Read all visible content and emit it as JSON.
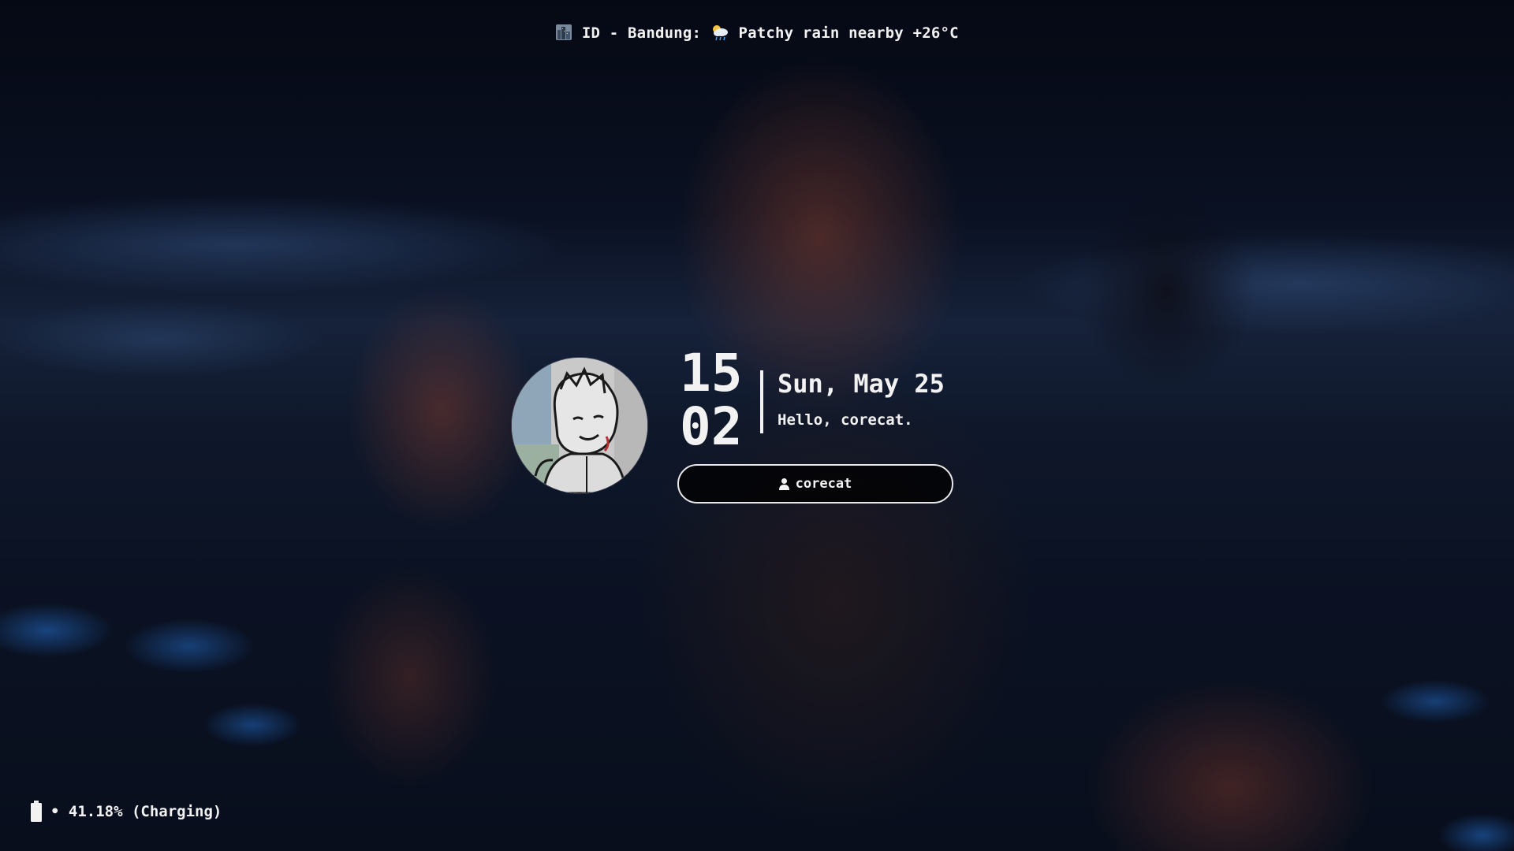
{
  "weather": {
    "location_icon": "cityscape-icon",
    "location": "ID - Bandung:",
    "condition_icon": "sun-behind-rain-cloud-icon",
    "condition": "Patchy rain nearby +26°C"
  },
  "avatar": {
    "icon": "user-avatar-sketch"
  },
  "clock": {
    "hours": "15",
    "minutes": "02"
  },
  "date": {
    "label": "Sun, May 25",
    "greeting": "Hello, corecat."
  },
  "login": {
    "user_icon": "user-icon",
    "username": "corecat"
  },
  "battery": {
    "icon": "battery-icon",
    "status": "• 41.18% (Charging)",
    "level_percent": 41.18
  },
  "colors": {
    "text": "#f2f2f2",
    "field_border": "#e8e8e8",
    "field_bg": "#000000"
  }
}
